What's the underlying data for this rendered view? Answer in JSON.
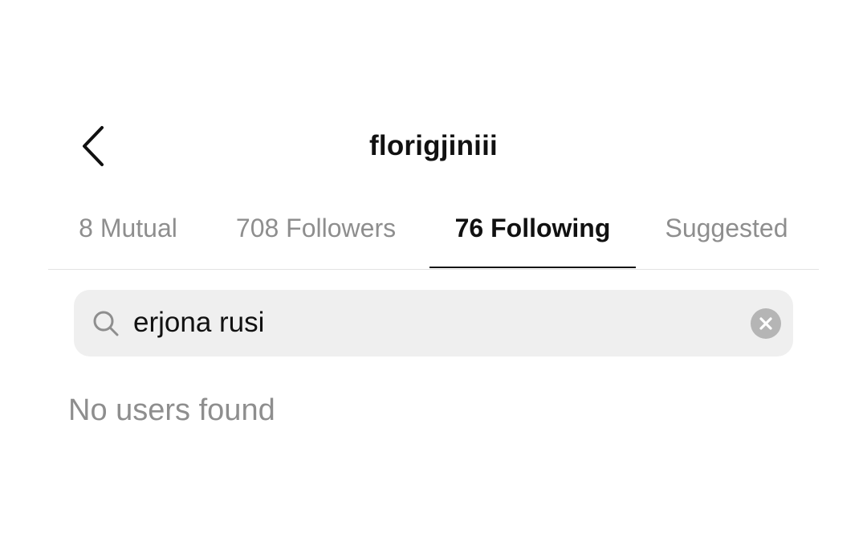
{
  "header": {
    "title": "florigjiniii",
    "back_icon": "chevron-left-icon"
  },
  "tabs": [
    {
      "label": "8 Mutual",
      "active": false
    },
    {
      "label": "708 Followers",
      "active": false
    },
    {
      "label": "76 Following",
      "active": true
    },
    {
      "label": "Suggested",
      "active": false
    }
  ],
  "search": {
    "icon": "search-icon",
    "value": "erjona rusi",
    "clear_icon": "clear-icon"
  },
  "results": {
    "empty_message": "No users found"
  },
  "colors": {
    "active_text": "#111111",
    "inactive_text": "#8e8e8e",
    "search_bg": "#efefef",
    "clear_bg": "#b5b5b5"
  }
}
